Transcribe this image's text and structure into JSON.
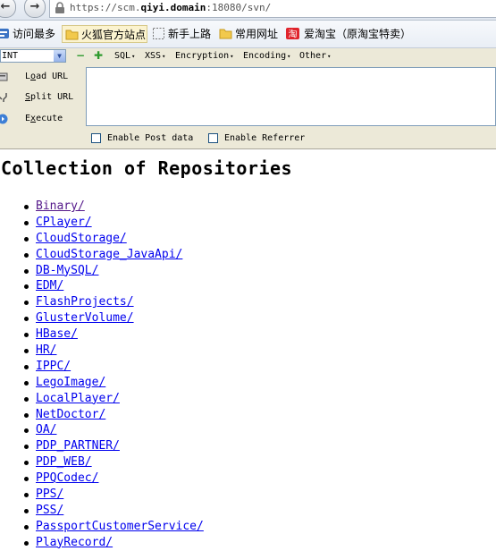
{
  "browser": {
    "url_prefix": "https://scm.",
    "url_domain": "qiyi.domain",
    "url_suffix": ":18080/svn/"
  },
  "bookmarks": [
    {
      "label": "访问最多",
      "icon": "recent-icon"
    },
    {
      "label": "火狐官方站点",
      "icon": "folder-icon"
    },
    {
      "label": "新手上路",
      "icon": "dashed-page-icon"
    },
    {
      "label": "常用网址",
      "icon": "folder-icon"
    },
    {
      "label": "爱淘宝（原淘宝特卖）",
      "icon": "taobao-icon"
    }
  ],
  "hackbar": {
    "select_value": "INT",
    "menus": [
      "SQL",
      "XSS",
      "Encryption",
      "Encoding",
      "Other"
    ],
    "load_url": {
      "prefix": "L",
      "underlined": "o",
      "rest": "ad URL"
    },
    "split_url": {
      "prefix": "",
      "underlined": "S",
      "rest": "plit URL"
    },
    "execute": {
      "prefix": "E",
      "underlined": "x",
      "rest": "ecute"
    },
    "enable_post": "Enable Post data",
    "enable_referrer": "Enable Referrer",
    "colors": {
      "background": "#ece9d8",
      "minus": "#2e9a2e",
      "plus": "#2e9a2e"
    }
  },
  "page": {
    "title": "Collection of Repositories",
    "link_color": "#0000ee",
    "visited_color": "#551a8b",
    "repos": [
      {
        "name": "Binary/",
        "visited": true
      },
      {
        "name": "CPlayer/",
        "visited": false
      },
      {
        "name": "CloudStorage/",
        "visited": false
      },
      {
        "name": "CloudStorage_JavaApi/",
        "visited": false
      },
      {
        "name": "DB-MySQL/",
        "visited": false
      },
      {
        "name": "EDM/",
        "visited": false
      },
      {
        "name": "FlashProjects/",
        "visited": false
      },
      {
        "name": "GlusterVolume/",
        "visited": false
      },
      {
        "name": "HBase/",
        "visited": false
      },
      {
        "name": "HR/",
        "visited": false
      },
      {
        "name": "IPPC/",
        "visited": false
      },
      {
        "name": "LegoImage/",
        "visited": false
      },
      {
        "name": "LocalPlayer/",
        "visited": false
      },
      {
        "name": "NetDoctor/",
        "visited": false
      },
      {
        "name": "OA/",
        "visited": false
      },
      {
        "name": "PDP_PARTNER/",
        "visited": false
      },
      {
        "name": "PDP_WEB/",
        "visited": false
      },
      {
        "name": "PPQCodec/",
        "visited": false
      },
      {
        "name": "PPS/",
        "visited": false
      },
      {
        "name": "PSS/",
        "visited": false
      },
      {
        "name": "PassportCustomerService/",
        "visited": false
      },
      {
        "name": "PlayRecord/",
        "visited": false
      }
    ]
  }
}
